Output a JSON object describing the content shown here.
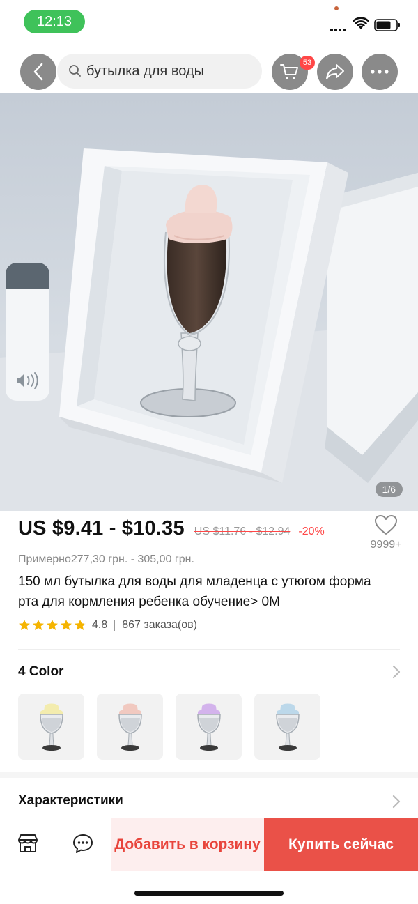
{
  "status_bar": {
    "time": "12:13"
  },
  "nav": {
    "search_query": "бутылка для воды",
    "cart_count": "53"
  },
  "gallery": {
    "counter": "1/6",
    "volume_level": 0.19
  },
  "product": {
    "price": "US $9.41 - $10.35",
    "old_price": "US $11.76 - $12.94",
    "discount": "-20%",
    "wishlist_count": "9999+",
    "approx_price": "Примерно277,30 грн. - 305,00 грн.",
    "title": "150 мл бутылка для воды для младенца с утюгом форма рта для кормления ребенка обучение> 0M",
    "rating": "4.8",
    "rating_stars": 4.8,
    "orders": "867 заказа(ов)"
  },
  "colors": {
    "title": "4 Color",
    "options": [
      {
        "lid_color": "#f3ecae"
      },
      {
        "lid_color": "#f1c9c0"
      },
      {
        "lid_color": "#d3b3ec"
      },
      {
        "lid_color": "#bcd8ea"
      }
    ]
  },
  "specs": {
    "title": "Характеристики"
  },
  "actions": {
    "add_to_cart": "Добавить в корзину",
    "buy_now": "Купить сейчас"
  },
  "theme": {
    "accent": "#ea5148",
    "status_green": "#3fc25a",
    "badge_red": "#ff4747",
    "star": "#f5b400"
  }
}
